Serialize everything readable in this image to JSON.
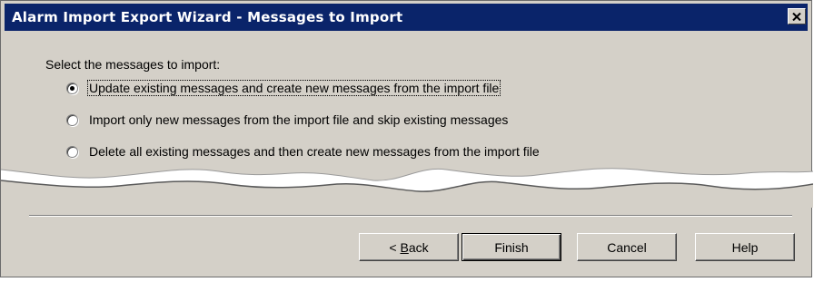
{
  "window": {
    "title": "Alarm Import Export Wizard - Messages to Import",
    "close_icon": "close-icon"
  },
  "main": {
    "prompt": "Select the messages to import:",
    "options": [
      {
        "label": "Update existing messages and create new messages from the import file",
        "selected": true
      },
      {
        "label": "Import only new messages from the import file and skip existing messages",
        "selected": false
      },
      {
        "label": "Delete all existing messages and then create new messages from the import file",
        "selected": false
      }
    ]
  },
  "buttons": {
    "back_arrow": "<",
    "back_label": "Back",
    "finish_label": "Finish",
    "cancel_label": "Cancel",
    "help_label": "Help"
  },
  "colors": {
    "titlebar": "#0a246a",
    "dialog_face": "#d4d0c8"
  }
}
